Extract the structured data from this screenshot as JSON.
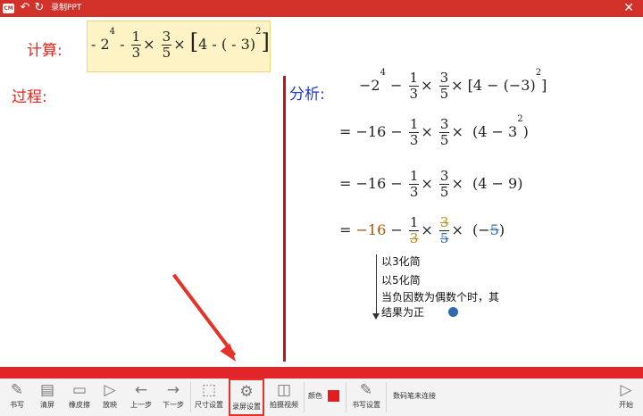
{
  "window": {
    "logo": "CM",
    "title": "录制PPT",
    "icons": {
      "undo": "undo-icon",
      "redo": "redo-icon",
      "close": "close-icon"
    }
  },
  "slide": {
    "calc_label": "计算:",
    "process_label": "过程:",
    "analysis_label": "分析:",
    "notes": [
      "以3化简",
      "以5化简",
      "当负因数为偶数个时，其",
      "结果为正"
    ]
  },
  "toolbar": {
    "write": "书写",
    "clear": "清屏",
    "eraser": "橡皮擦",
    "play": "放映",
    "prev": "上一步",
    "next": "下一步",
    "size_settings": "尺寸设置",
    "record_settings": "录屏设置",
    "camera_video": "拍摄视频",
    "color_label": "颜色",
    "pen_settings": "书写设置",
    "pen_status": "数码笔未连接",
    "start": "开始",
    "current_color": "#e51c1c"
  }
}
